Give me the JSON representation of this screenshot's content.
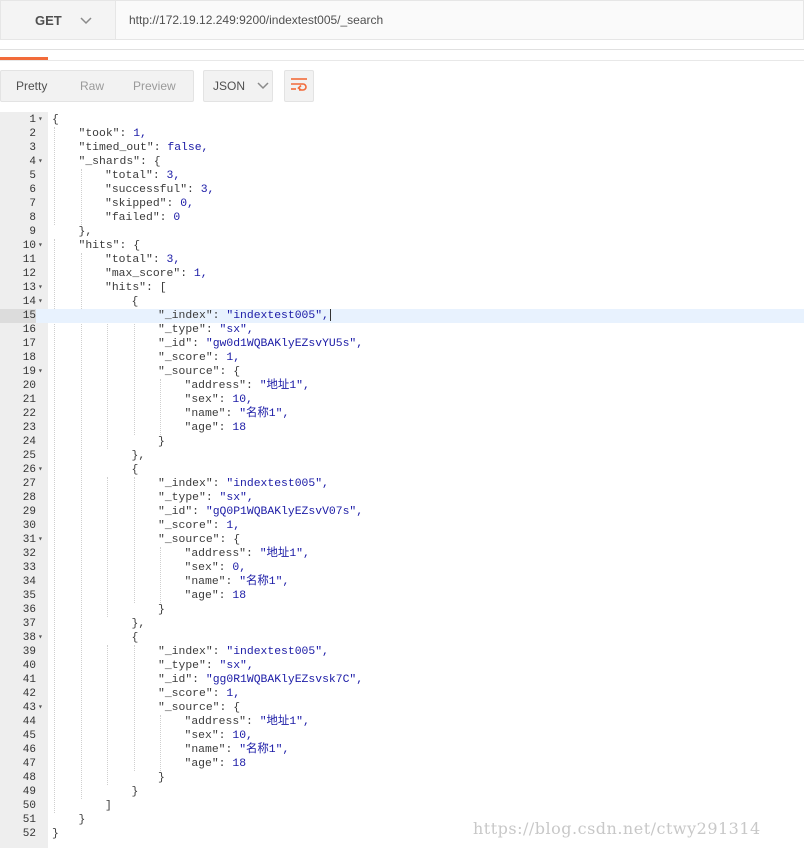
{
  "request": {
    "method": "GET",
    "url": "http://172.19.12.249:9200/indextest005/_search"
  },
  "response_tabs": {
    "pretty": "Pretty",
    "raw": "Raw",
    "preview": "Preview",
    "format": "JSON"
  },
  "icons": {
    "method_dropdown": "chevron-down-icon",
    "format_dropdown": "chevron-down-icon",
    "wrap": "wrap-lines-icon",
    "fold": "fold-triangle-icon"
  },
  "colors": {
    "accent": "#f26b3a",
    "string": "#1a1aa6",
    "active_line": "#e8f2fe"
  },
  "active_line": 15,
  "code_lines": [
    {
      "n": "1",
      "fold": true,
      "indent": 0,
      "key": "",
      "val": "{",
      "type": "p"
    },
    {
      "n": "2",
      "fold": false,
      "indent": 1,
      "key": "\"took\": ",
      "val": "1,",
      "type": "n"
    },
    {
      "n": "3",
      "fold": false,
      "indent": 1,
      "key": "\"timed_out\": ",
      "val": "false,",
      "type": "b"
    },
    {
      "n": "4",
      "fold": true,
      "indent": 1,
      "key": "\"_shards\": ",
      "val": "{",
      "type": "p"
    },
    {
      "n": "5",
      "fold": false,
      "indent": 2,
      "key": "\"total\": ",
      "val": "3,",
      "type": "n"
    },
    {
      "n": "6",
      "fold": false,
      "indent": 2,
      "key": "\"successful\": ",
      "val": "3,",
      "type": "n"
    },
    {
      "n": "7",
      "fold": false,
      "indent": 2,
      "key": "\"skipped\": ",
      "val": "0,",
      "type": "n"
    },
    {
      "n": "8",
      "fold": false,
      "indent": 2,
      "key": "\"failed\": ",
      "val": "0",
      "type": "n"
    },
    {
      "n": "9",
      "fold": false,
      "indent": 1,
      "key": "",
      "val": "},",
      "type": "p"
    },
    {
      "n": "10",
      "fold": true,
      "indent": 1,
      "key": "\"hits\": ",
      "val": "{",
      "type": "p"
    },
    {
      "n": "11",
      "fold": false,
      "indent": 2,
      "key": "\"total\": ",
      "val": "3,",
      "type": "n"
    },
    {
      "n": "12",
      "fold": false,
      "indent": 2,
      "key": "\"max_score\": ",
      "val": "1,",
      "type": "n"
    },
    {
      "n": "13",
      "fold": true,
      "indent": 2,
      "key": "\"hits\": ",
      "val": "[",
      "type": "p"
    },
    {
      "n": "14",
      "fold": true,
      "indent": 3,
      "key": "",
      "val": "{",
      "type": "p"
    },
    {
      "n": "15",
      "fold": false,
      "indent": 4,
      "key": "\"_index\": ",
      "val": "\"indextest005\",",
      "type": "s"
    },
    {
      "n": "16",
      "fold": false,
      "indent": 4,
      "key": "\"_type\": ",
      "val": "\"sx\",",
      "type": "s"
    },
    {
      "n": "17",
      "fold": false,
      "indent": 4,
      "key": "\"_id\": ",
      "val": "\"gw0d1WQBAKlyEZsvYU5s\",",
      "type": "s"
    },
    {
      "n": "18",
      "fold": false,
      "indent": 4,
      "key": "\"_score\": ",
      "val": "1,",
      "type": "n"
    },
    {
      "n": "19",
      "fold": true,
      "indent": 4,
      "key": "\"_source\": ",
      "val": "{",
      "type": "p"
    },
    {
      "n": "20",
      "fold": false,
      "indent": 5,
      "key": "\"address\": ",
      "val": "\"地址1\",",
      "type": "s"
    },
    {
      "n": "21",
      "fold": false,
      "indent": 5,
      "key": "\"sex\": ",
      "val": "10,",
      "type": "n"
    },
    {
      "n": "22",
      "fold": false,
      "indent": 5,
      "key": "\"name\": ",
      "val": "\"名称1\",",
      "type": "s"
    },
    {
      "n": "23",
      "fold": false,
      "indent": 5,
      "key": "\"age\": ",
      "val": "18",
      "type": "n"
    },
    {
      "n": "24",
      "fold": false,
      "indent": 4,
      "key": "",
      "val": "}",
      "type": "p"
    },
    {
      "n": "25",
      "fold": false,
      "indent": 3,
      "key": "",
      "val": "},",
      "type": "p"
    },
    {
      "n": "26",
      "fold": true,
      "indent": 3,
      "key": "",
      "val": "{",
      "type": "p"
    },
    {
      "n": "27",
      "fold": false,
      "indent": 4,
      "key": "\"_index\": ",
      "val": "\"indextest005\",",
      "type": "s"
    },
    {
      "n": "28",
      "fold": false,
      "indent": 4,
      "key": "\"_type\": ",
      "val": "\"sx\",",
      "type": "s"
    },
    {
      "n": "29",
      "fold": false,
      "indent": 4,
      "key": "\"_id\": ",
      "val": "\"gQ0P1WQBAKlyEZsvV07s\",",
      "type": "s"
    },
    {
      "n": "30",
      "fold": false,
      "indent": 4,
      "key": "\"_score\": ",
      "val": "1,",
      "type": "n"
    },
    {
      "n": "31",
      "fold": true,
      "indent": 4,
      "key": "\"_source\": ",
      "val": "{",
      "type": "p"
    },
    {
      "n": "32",
      "fold": false,
      "indent": 5,
      "key": "\"address\": ",
      "val": "\"地址1\",",
      "type": "s"
    },
    {
      "n": "33",
      "fold": false,
      "indent": 5,
      "key": "\"sex\": ",
      "val": "0,",
      "type": "n"
    },
    {
      "n": "34",
      "fold": false,
      "indent": 5,
      "key": "\"name\": ",
      "val": "\"名称1\",",
      "type": "s"
    },
    {
      "n": "35",
      "fold": false,
      "indent": 5,
      "key": "\"age\": ",
      "val": "18",
      "type": "n"
    },
    {
      "n": "36",
      "fold": false,
      "indent": 4,
      "key": "",
      "val": "}",
      "type": "p"
    },
    {
      "n": "37",
      "fold": false,
      "indent": 3,
      "key": "",
      "val": "},",
      "type": "p"
    },
    {
      "n": "38",
      "fold": true,
      "indent": 3,
      "key": "",
      "val": "{",
      "type": "p"
    },
    {
      "n": "39",
      "fold": false,
      "indent": 4,
      "key": "\"_index\": ",
      "val": "\"indextest005\",",
      "type": "s"
    },
    {
      "n": "40",
      "fold": false,
      "indent": 4,
      "key": "\"_type\": ",
      "val": "\"sx\",",
      "type": "s"
    },
    {
      "n": "41",
      "fold": false,
      "indent": 4,
      "key": "\"_id\": ",
      "val": "\"gg0R1WQBAKlyEZsvsk7C\",",
      "type": "s"
    },
    {
      "n": "42",
      "fold": false,
      "indent": 4,
      "key": "\"_score\": ",
      "val": "1,",
      "type": "n"
    },
    {
      "n": "43",
      "fold": true,
      "indent": 4,
      "key": "\"_source\": ",
      "val": "{",
      "type": "p"
    },
    {
      "n": "44",
      "fold": false,
      "indent": 5,
      "key": "\"address\": ",
      "val": "\"地址1\",",
      "type": "s"
    },
    {
      "n": "45",
      "fold": false,
      "indent": 5,
      "key": "\"sex\": ",
      "val": "10,",
      "type": "n"
    },
    {
      "n": "46",
      "fold": false,
      "indent": 5,
      "key": "\"name\": ",
      "val": "\"名称1\",",
      "type": "s"
    },
    {
      "n": "47",
      "fold": false,
      "indent": 5,
      "key": "\"age\": ",
      "val": "18",
      "type": "n"
    },
    {
      "n": "48",
      "fold": false,
      "indent": 4,
      "key": "",
      "val": "}",
      "type": "p"
    },
    {
      "n": "49",
      "fold": false,
      "indent": 3,
      "key": "",
      "val": "}",
      "type": "p"
    },
    {
      "n": "50",
      "fold": false,
      "indent": 2,
      "key": "",
      "val": "]",
      "type": "p"
    },
    {
      "n": "51",
      "fold": false,
      "indent": 1,
      "key": "",
      "val": "}",
      "type": "p"
    },
    {
      "n": "52",
      "fold": false,
      "indent": 0,
      "key": "",
      "val": "}",
      "type": "p"
    }
  ],
  "watermark": "https://blog.csdn.net/ctwy291314"
}
